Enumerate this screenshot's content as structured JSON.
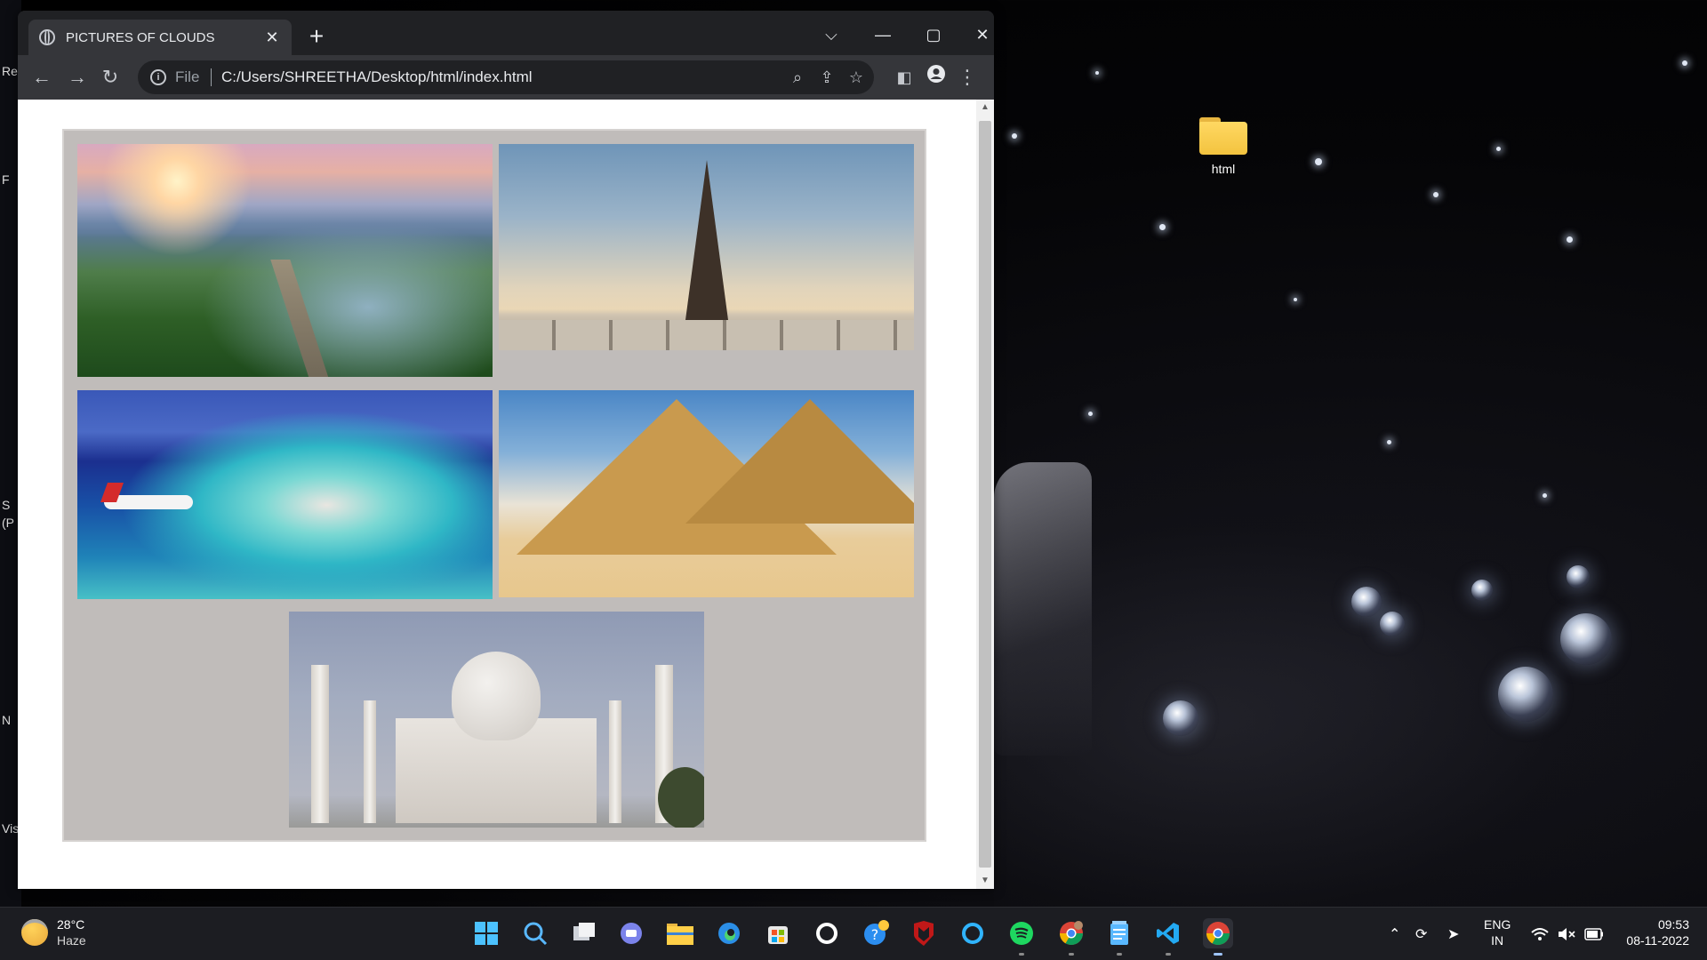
{
  "desktop": {
    "folder_label": "html",
    "left_edge_fragments": [
      "Re",
      "F",
      "S",
      "(P",
      "N",
      "Vis"
    ]
  },
  "browser": {
    "tab_title": "PICTURES OF CLOUDS",
    "tab_close_glyph": "✕",
    "new_tab_glyph": "+",
    "window_controls": {
      "dropdown": "⌵",
      "minimize": "—",
      "maximize": "▢",
      "close": "✕"
    },
    "toolbar": {
      "back": "←",
      "forward": "→",
      "reload": "↻"
    },
    "address": {
      "scheme": "File",
      "url": "C:/Users/SHREETHA/Desktop/html/index.html"
    },
    "address_icons": [
      "zoom-icon",
      "share-icon",
      "bookmark-star-icon"
    ],
    "extra_icons": [
      "side-panel-icon",
      "profile-icon",
      "menu-icon"
    ]
  },
  "page": {
    "images": [
      {
        "name": "great-wall-image",
        "description_icon": "great-wall"
      },
      {
        "name": "eiffel-tower-image",
        "description_icon": "eiffel-tower"
      },
      {
        "name": "maldives-island-image",
        "description_icon": "island"
      },
      {
        "name": "pyramids-image",
        "description_icon": "pyramids"
      },
      {
        "name": "taj-mahal-image",
        "description_icon": "taj-mahal"
      }
    ],
    "colors": {
      "gallery_bg": "#c0bcba",
      "page_bg": "#ffffff"
    }
  },
  "taskbar": {
    "weather": {
      "temp": "28°C",
      "condition": "Haze"
    },
    "apps": [
      "start",
      "search",
      "task-view",
      "teams-chat",
      "file-explorer",
      "edge",
      "microsoft-store",
      "github",
      "help",
      "mcafee",
      "cortana",
      "spotify",
      "chrome-canary",
      "notepad",
      "vscode",
      "chrome"
    ],
    "tray": {
      "lang_top": "ENG",
      "lang_bottom": "IN",
      "time": "09:53",
      "date": "08-11-2022"
    }
  }
}
